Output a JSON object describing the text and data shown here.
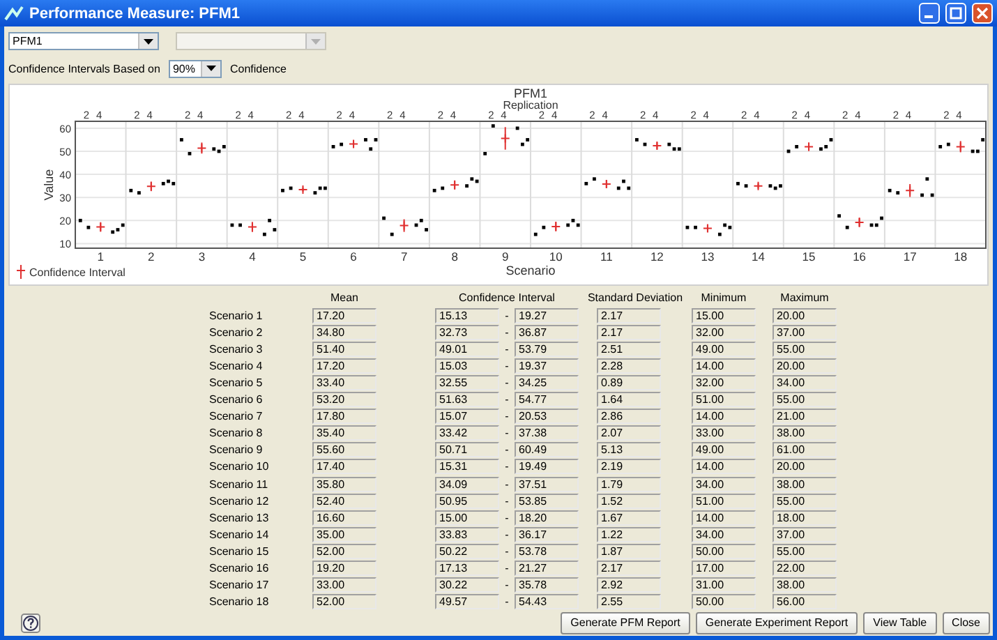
{
  "window": {
    "title": "Performance Measure: PFM1"
  },
  "measure_select": {
    "value": "PFM1"
  },
  "secondary_select": {
    "disabled": true
  },
  "confidence_row": {
    "label": "Confidence Intervals Based on",
    "value": "90%",
    "suffix": "Confidence"
  },
  "chart": {
    "top_axis": {
      "label": "Replication",
      "ticks": [
        [
          "2",
          "4"
        ],
        [
          "2",
          "4"
        ],
        [
          "2",
          "4"
        ],
        [
          "2",
          "4"
        ],
        [
          "2",
          "4"
        ],
        [
          "2",
          "4"
        ],
        [
          "2",
          "4"
        ],
        [
          "2",
          "4"
        ],
        [
          "2",
          "4"
        ],
        [
          "2",
          "4"
        ],
        [
          "2",
          "4"
        ],
        [
          "2",
          "4"
        ],
        [
          "2",
          "4"
        ],
        [
          "2",
          "4"
        ],
        [
          "2",
          "4"
        ],
        [
          "2",
          "4"
        ],
        [
          "2",
          "4"
        ],
        [
          "2",
          "4"
        ]
      ]
    },
    "chart_data": {
      "type": "scatter",
      "title": "PFM1",
      "xlabel": "Scenario",
      "ylabel": "Value",
      "grid": true,
      "x": [
        0.6,
        0.76,
        1,
        1.24,
        1.34,
        1.44,
        1.6,
        1.76,
        2,
        2.24,
        2.34,
        2.44,
        2.6,
        2.76,
        3,
        3.24,
        3.34,
        3.44,
        3.6,
        3.76,
        4,
        4.24,
        4.34,
        4.44,
        4.6,
        4.76,
        5,
        5.24,
        5.34,
        5.44,
        5.6,
        5.76,
        6,
        6.24,
        6.34,
        6.44,
        6.6,
        6.76,
        7,
        7.24,
        7.34,
        7.44,
        7.6,
        7.76,
        8,
        8.24,
        8.34,
        8.44,
        8.6,
        8.76,
        9,
        9.24,
        9.34,
        9.44,
        9.6,
        9.76,
        10,
        10.24,
        10.34,
        10.44,
        10.6,
        10.76,
        11,
        11.24,
        11.34,
        11.44,
        11.6,
        11.76,
        12,
        12.24,
        12.34,
        12.44,
        12.6,
        12.76,
        13,
        13.24,
        13.34,
        13.44,
        13.6,
        13.76,
        14,
        14.24,
        14.34,
        14.44,
        14.6,
        14.76,
        15,
        15.24,
        15.34,
        15.44,
        15.6,
        15.76,
        16,
        16.24,
        16.34,
        16.44,
        16.6,
        16.76,
        17,
        17.24,
        17.34,
        17.44,
        17.6,
        17.76,
        18,
        18.24,
        18.34,
        18.44
      ],
      "xlim": [
        0.5,
        18.5
      ],
      "xticks": [
        1,
        2,
        3,
        4,
        5,
        6,
        7,
        8,
        9,
        10,
        11,
        12,
        13,
        14,
        15,
        16,
        17,
        18
      ],
      "ylim": [
        8,
        63
      ],
      "yticks": [
        10,
        20,
        30,
        40,
        50,
        60
      ],
      "series": [
        {
          "color": "#000000",
          "values": [
            20,
            17,
            null,
            15,
            16,
            18,
            33,
            32,
            null,
            36,
            37,
            36,
            55,
            49,
            null,
            51,
            50,
            52,
            18,
            18,
            null,
            14,
            20,
            16,
            33,
            34,
            null,
            32,
            34,
            34,
            52,
            53,
            null,
            55,
            51,
            55,
            21,
            14,
            null,
            18,
            20,
            16,
            33,
            34,
            null,
            35,
            38,
            37,
            49,
            61,
            null,
            60,
            53,
            55,
            14,
            17,
            null,
            18,
            20,
            18,
            36,
            38,
            null,
            34,
            37,
            34,
            55,
            53,
            null,
            53,
            51,
            51,
            17,
            17,
            null,
            14,
            18,
            17,
            36,
            35,
            null,
            35,
            34,
            35,
            50,
            52,
            null,
            51,
            52,
            55,
            22,
            17,
            null,
            18,
            18,
            21,
            33,
            32,
            null,
            31,
            38,
            31,
            52,
            53,
            null,
            50,
            50,
            55
          ]
        },
        {
          "name": "Confidence Interval",
          "color": "#e03030",
          "values": [
            null,
            null,
            17.2,
            null,
            null,
            null,
            null,
            null,
            34.8,
            null,
            null,
            null,
            null,
            null,
            51.4,
            null,
            null,
            null,
            null,
            null,
            17.2,
            null,
            null,
            null,
            null,
            null,
            33.4,
            null,
            null,
            null,
            null,
            null,
            53.2,
            null,
            null,
            null,
            null,
            null,
            17.8,
            null,
            null,
            null,
            null,
            null,
            35.4,
            null,
            null,
            null,
            null,
            null,
            55.6,
            null,
            null,
            null,
            null,
            null,
            17.4,
            null,
            null,
            null,
            null,
            null,
            35.8,
            null,
            null,
            null,
            null,
            null,
            52.4,
            null,
            null,
            null,
            null,
            null,
            16.6,
            null,
            null,
            null,
            null,
            null,
            35.0,
            null,
            null,
            null,
            null,
            null,
            52.0,
            null,
            null,
            null,
            null,
            null,
            19.2,
            null,
            null,
            null,
            null,
            null,
            33.0,
            null,
            null,
            null,
            null,
            null,
            52.0,
            null,
            null,
            null
          ]
        }
      ]
    }
  },
  "table": {
    "columns": [
      "Mean",
      "Confidence Interval",
      "Standard Deviation",
      "Minimum",
      "Maximum"
    ],
    "separator": "-",
    "rows": [
      {
        "label": "Scenario 1",
        "mean": "17.20",
        "ci_low": "15.13",
        "ci_high": "19.27",
        "sd": "2.17",
        "min": "15.00",
        "max": "20.00"
      },
      {
        "label": "Scenario 2",
        "mean": "34.80",
        "ci_low": "32.73",
        "ci_high": "36.87",
        "sd": "2.17",
        "min": "32.00",
        "max": "37.00"
      },
      {
        "label": "Scenario 3",
        "mean": "51.40",
        "ci_low": "49.01",
        "ci_high": "53.79",
        "sd": "2.51",
        "min": "49.00",
        "max": "55.00"
      },
      {
        "label": "Scenario 4",
        "mean": "17.20",
        "ci_low": "15.03",
        "ci_high": "19.37",
        "sd": "2.28",
        "min": "14.00",
        "max": "20.00"
      },
      {
        "label": "Scenario 5",
        "mean": "33.40",
        "ci_low": "32.55",
        "ci_high": "34.25",
        "sd": "0.89",
        "min": "32.00",
        "max": "34.00"
      },
      {
        "label": "Scenario 6",
        "mean": "53.20",
        "ci_low": "51.63",
        "ci_high": "54.77",
        "sd": "1.64",
        "min": "51.00",
        "max": "55.00"
      },
      {
        "label": "Scenario 7",
        "mean": "17.80",
        "ci_low": "15.07",
        "ci_high": "20.53",
        "sd": "2.86",
        "min": "14.00",
        "max": "21.00"
      },
      {
        "label": "Scenario 8",
        "mean": "35.40",
        "ci_low": "33.42",
        "ci_high": "37.38",
        "sd": "2.07",
        "min": "33.00",
        "max": "38.00"
      },
      {
        "label": "Scenario 9",
        "mean": "55.60",
        "ci_low": "50.71",
        "ci_high": "60.49",
        "sd": "5.13",
        "min": "49.00",
        "max": "61.00"
      },
      {
        "label": "Scenario 10",
        "mean": "17.40",
        "ci_low": "15.31",
        "ci_high": "19.49",
        "sd": "2.19",
        "min": "14.00",
        "max": "20.00"
      },
      {
        "label": "Scenario 11",
        "mean": "35.80",
        "ci_low": "34.09",
        "ci_high": "37.51",
        "sd": "1.79",
        "min": "34.00",
        "max": "38.00"
      },
      {
        "label": "Scenario 12",
        "mean": "52.40",
        "ci_low": "50.95",
        "ci_high": "53.85",
        "sd": "1.52",
        "min": "51.00",
        "max": "55.00"
      },
      {
        "label": "Scenario 13",
        "mean": "16.60",
        "ci_low": "15.00",
        "ci_high": "18.20",
        "sd": "1.67",
        "min": "14.00",
        "max": "18.00"
      },
      {
        "label": "Scenario 14",
        "mean": "35.00",
        "ci_low": "33.83",
        "ci_high": "36.17",
        "sd": "1.22",
        "min": "34.00",
        "max": "37.00"
      },
      {
        "label": "Scenario 15",
        "mean": "52.00",
        "ci_low": "50.22",
        "ci_high": "53.78",
        "sd": "1.87",
        "min": "50.00",
        "max": "55.00"
      },
      {
        "label": "Scenario 16",
        "mean": "19.20",
        "ci_low": "17.13",
        "ci_high": "21.27",
        "sd": "2.17",
        "min": "17.00",
        "max": "22.00"
      },
      {
        "label": "Scenario 17",
        "mean": "33.00",
        "ci_low": "30.22",
        "ci_high": "35.78",
        "sd": "2.92",
        "min": "31.00",
        "max": "38.00"
      },
      {
        "label": "Scenario 18",
        "mean": "52.00",
        "ci_low": "49.57",
        "ci_high": "54.43",
        "sd": "2.55",
        "min": "50.00",
        "max": "56.00"
      }
    ]
  },
  "buttons": [
    "Generate PFM Report",
    "Generate Experiment Report",
    "View Table",
    "Close"
  ]
}
